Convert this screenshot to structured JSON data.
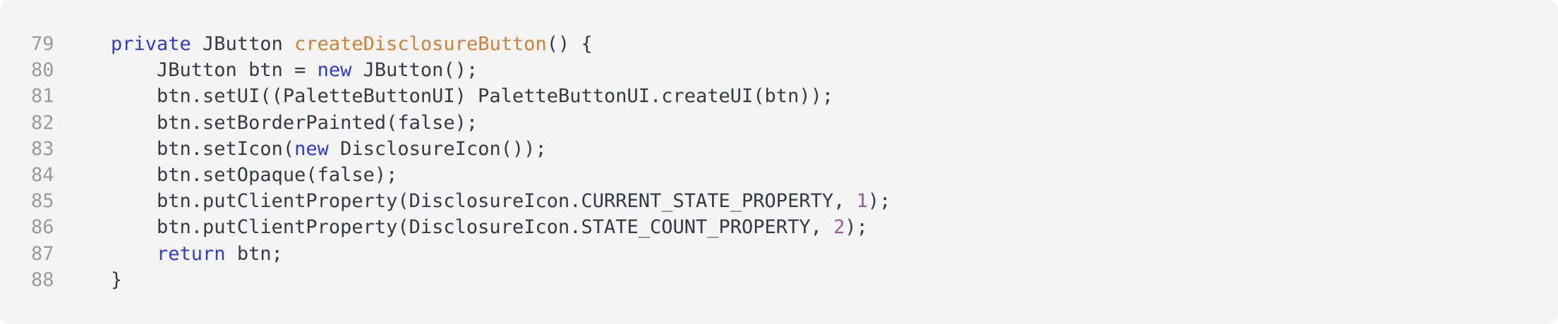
{
  "code_block": {
    "colors": {
      "background": "#f4f4f4",
      "line_number": "#9a9a9a",
      "plain": "#383a42",
      "keyword": "#2f3bd6",
      "method": "#d38136",
      "number": "#9c5a9a"
    },
    "lines": [
      {
        "number": "79",
        "tokens": [
          {
            "t": "private",
            "k": "keyword"
          },
          {
            "t": " JButton ",
            "k": "plain"
          },
          {
            "t": "createDisclosureButton",
            "k": "method"
          },
          {
            "t": "() {",
            "k": "plain"
          }
        ]
      },
      {
        "number": "80",
        "tokens": [
          {
            "t": "    JButton btn = ",
            "k": "plain"
          },
          {
            "t": "new",
            "k": "keyword"
          },
          {
            "t": " JButton();",
            "k": "plain"
          }
        ]
      },
      {
        "number": "81",
        "tokens": [
          {
            "t": "    btn.setUI((PaletteButtonUI) PaletteButtonUI.createUI(btn));",
            "k": "plain"
          }
        ]
      },
      {
        "number": "82",
        "tokens": [
          {
            "t": "    btn.setBorderPainted(false);",
            "k": "plain"
          }
        ]
      },
      {
        "number": "83",
        "tokens": [
          {
            "t": "    btn.setIcon(",
            "k": "plain"
          },
          {
            "t": "new",
            "k": "keyword"
          },
          {
            "t": " DisclosureIcon());",
            "k": "plain"
          }
        ]
      },
      {
        "number": "84",
        "tokens": [
          {
            "t": "    btn.setOpaque(false);",
            "k": "plain"
          }
        ]
      },
      {
        "number": "85",
        "tokens": [
          {
            "t": "    btn.putClientProperty(DisclosureIcon.CURRENT_STATE_PROPERTY, ",
            "k": "plain"
          },
          {
            "t": "1",
            "k": "number"
          },
          {
            "t": ");",
            "k": "plain"
          }
        ]
      },
      {
        "number": "86",
        "tokens": [
          {
            "t": "    btn.putClientProperty(DisclosureIcon.STATE_COUNT_PROPERTY, ",
            "k": "plain"
          },
          {
            "t": "2",
            "k": "number"
          },
          {
            "t": ");",
            "k": "plain"
          }
        ]
      },
      {
        "number": "87",
        "tokens": [
          {
            "t": "    ",
            "k": "plain"
          },
          {
            "t": "return",
            "k": "keyword"
          },
          {
            "t": " btn;",
            "k": "plain"
          }
        ]
      },
      {
        "number": "88",
        "tokens": [
          {
            "t": "}",
            "k": "plain"
          }
        ]
      }
    ]
  }
}
